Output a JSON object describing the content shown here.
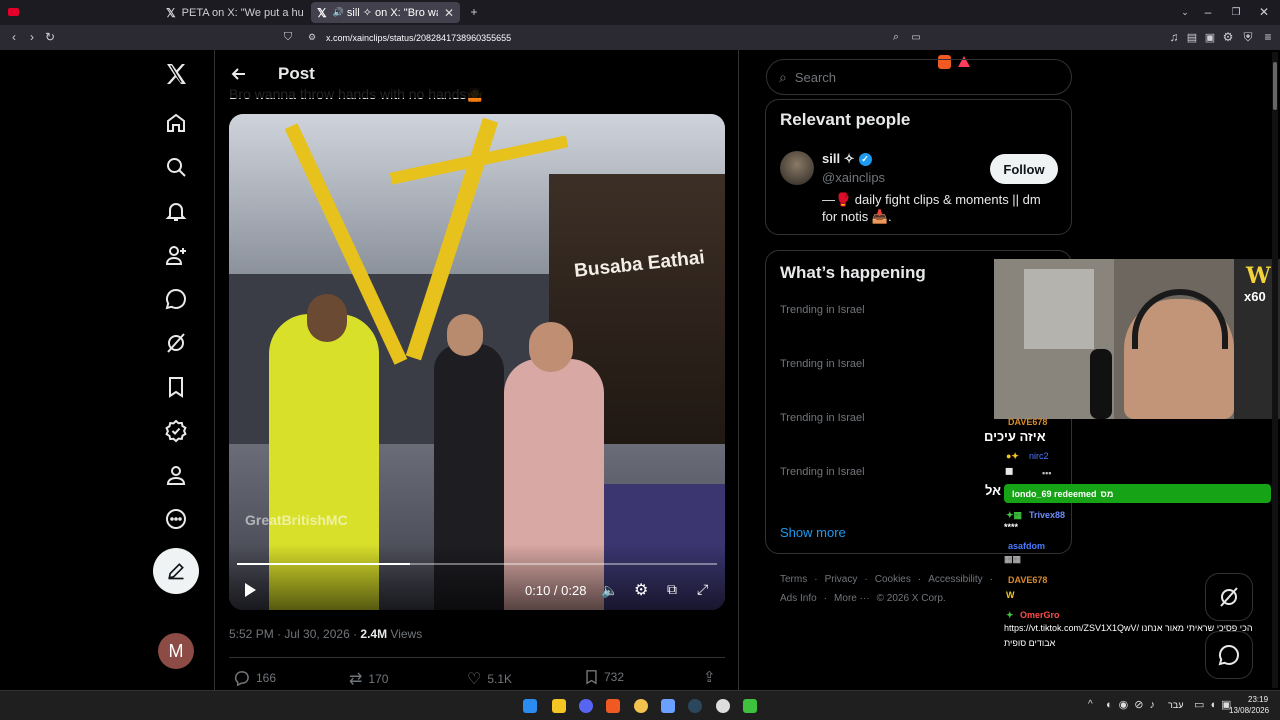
{
  "browser": {
    "tabs": [
      {
        "title": "PETA on X: \"We put a human \"lobste",
        "active": false
      },
      {
        "title": "sill ✧ on X: \"Bro wanna throw",
        "active": true
      }
    ],
    "url": "x.com/xainclips/status/2082841738960355655"
  },
  "nav": {
    "avatar_letter": "M",
    "icons": [
      "x-logo-icon",
      "home-icon",
      "explore-icon",
      "notifications-icon",
      "follow-icon",
      "messages-icon",
      "grok-icon",
      "bookmarks-icon",
      "verified-icon",
      "profile-icon",
      "more-icon",
      "compose-icon"
    ]
  },
  "post": {
    "header_title": "Post",
    "text_partial": "Bro wanna throw hands with no hands🤷",
    "watermark": "GreatBritishMC",
    "sign_text": "Busaba Eathai",
    "video_time": "0:10 / 0:28",
    "video_progress": 0.36,
    "meta_time": "5:52 PM · Jul 30, 2026 · ",
    "views": "2.4M",
    "views_label": " Views",
    "stats": {
      "replies": "166",
      "reposts": "170",
      "likes": "5.1K",
      "bookmarks": "732"
    }
  },
  "sidebar": {
    "search_placeholder": "Search",
    "relevant_title": "Relevant people",
    "person": {
      "name": "sill ✧",
      "handle": "@xainclips",
      "bio": "—🥊 daily fight clips & moments || dm for notis 📥.",
      "follow_label": "Follow"
    },
    "happening_title": "What’s happening",
    "trends": [
      "Trending in Israel",
      "Trending in Israel",
      "Trending in Israel",
      "Trending in Israel"
    ],
    "show_more": "Show more",
    "footer_row1": [
      "Terms",
      "·",
      "Privacy",
      "·",
      "Cookies",
      "·",
      "Accessibility",
      "·"
    ],
    "footer_row2": [
      "Ads Info",
      "·",
      "More ···",
      "© 2026 X Corp."
    ]
  },
  "overlay": {
    "badge_top": "W",
    "badge_bottom": "x60",
    "chat": [
      {
        "user": "DAVE678",
        "color": "#d98b2b",
        "msg": "איזה עיכים"
      },
      {
        "user": "nirc2",
        "color": "#4a7bff",
        "msg": ""
      },
      {
        "user": "londo_69 redeemed",
        "color": "#ffffff",
        "msg": "מס"
      },
      {
        "user": "Trivex88",
        "color": "#6a8cff",
        "msg": "****"
      },
      {
        "user": "asafdom",
        "color": "#4a7bff",
        "msg": ""
      },
      {
        "user": "DAVE678",
        "color": "#d98b2b",
        "msg": "W"
      },
      {
        "user": "OmerGro",
        "color": "#ff4a4a",
        "msg": "https://vt.tiktok.com/ZSV1X1QwV/ הכי פסיכי שראיתי מאור אנחנו"
      },
      {
        "user": "",
        "color": "#ffffff",
        "msg": "אבודים סופית"
      }
    ],
    "partial_heb": "אל"
  },
  "taskbar": {
    "lang": "עבר",
    "time": "23:19",
    "date": "13/08/2026"
  }
}
